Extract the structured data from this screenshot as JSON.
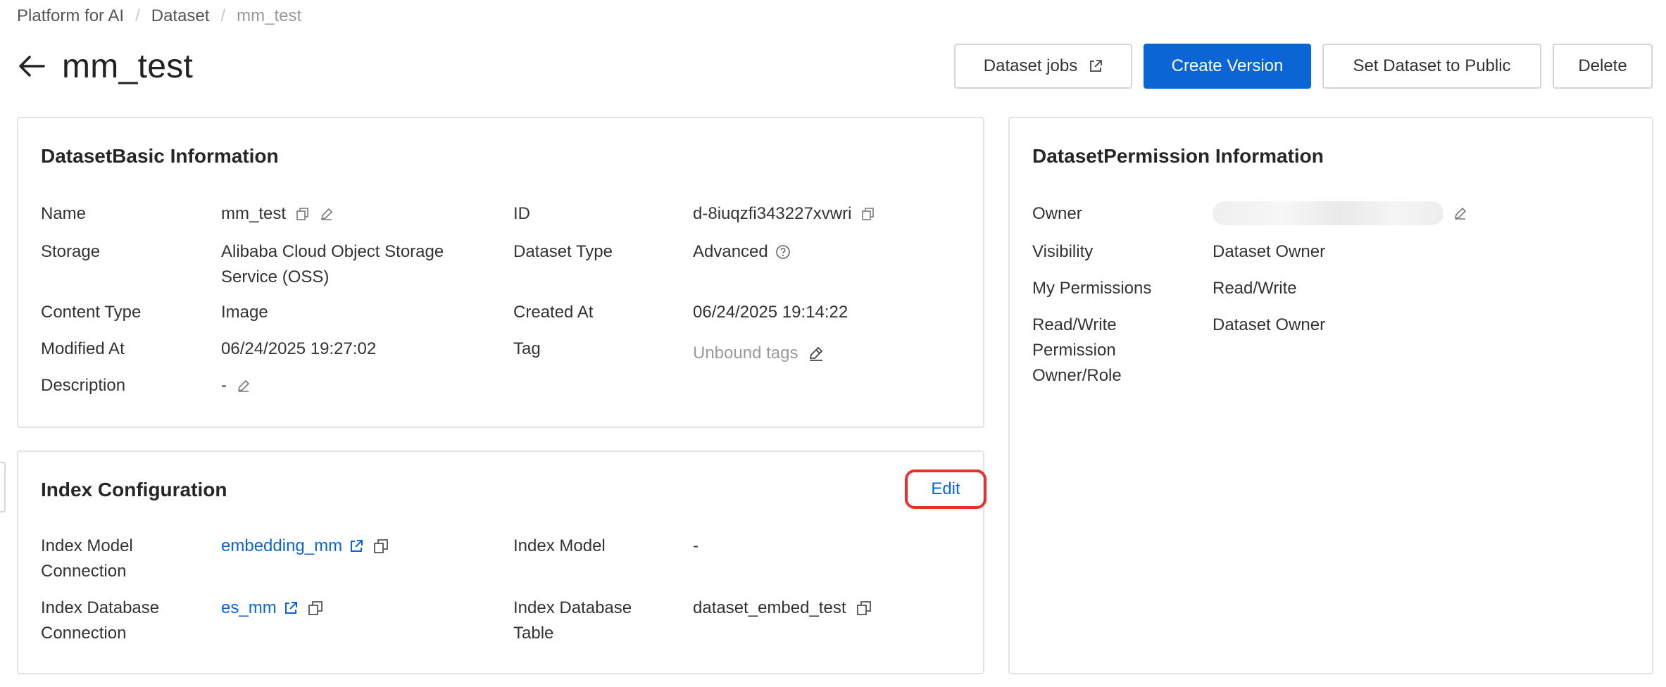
{
  "breadcrumb": {
    "item1": "Platform for AI",
    "item2": "Dataset",
    "current": "mm_test",
    "separator": "/"
  },
  "header": {
    "title": "mm_test"
  },
  "actions": {
    "dataset_jobs": "Dataset jobs",
    "create_version": "Create Version",
    "set_public": "Set Dataset to Public",
    "delete": "Delete"
  },
  "basic_info": {
    "title": "DatasetBasic Information",
    "name_label": "Name",
    "name_value": "mm_test",
    "id_label": "ID",
    "id_value": "d-8iuqzfi343227xvwri",
    "storage_label": "Storage",
    "storage_value_1": "Alibaba Cloud Object Storage",
    "storage_value_2": "Service (OSS)",
    "type_label": "Dataset Type",
    "type_value": "Advanced",
    "content_type_label": "Content Type",
    "content_type_value": "Image",
    "created_label": "Created At",
    "created_value": "06/24/2025 19:14:22",
    "modified_label": "Modified At",
    "modified_value": "06/24/2025 19:27:02",
    "tag_label": "Tag",
    "tag_value": "Unbound tags",
    "description_label": "Description",
    "description_value": "-"
  },
  "index_config": {
    "title": "Index Configuration",
    "edit": "Edit",
    "model_conn_label_1": "Index Model",
    "model_conn_label_2": "Connection",
    "model_conn_value": "embedding_mm",
    "model_label": "Index Model",
    "model_value": "-",
    "db_conn_label_1": "Index Database",
    "db_conn_label_2": "Connection",
    "db_conn_value": "es_mm",
    "db_table_label_1": "Index Database",
    "db_table_label_2": "Table",
    "db_table_value": "dataset_embed_test"
  },
  "permission_info": {
    "title": "DatasetPermission Information",
    "owner_label": "Owner",
    "visibility_label": "Visibility",
    "visibility_value": "Dataset Owner",
    "my_perm_label": "My Permissions",
    "my_perm_value": "Read/Write",
    "rw_label_1": "Read/Write",
    "rw_label_2": "Permission",
    "rw_label_3": "Owner/Role",
    "rw_value": "Dataset Owner"
  },
  "colors": {
    "primary": "#0b65d4",
    "highlight": "#e5322d",
    "border": "#e3e3e3"
  }
}
